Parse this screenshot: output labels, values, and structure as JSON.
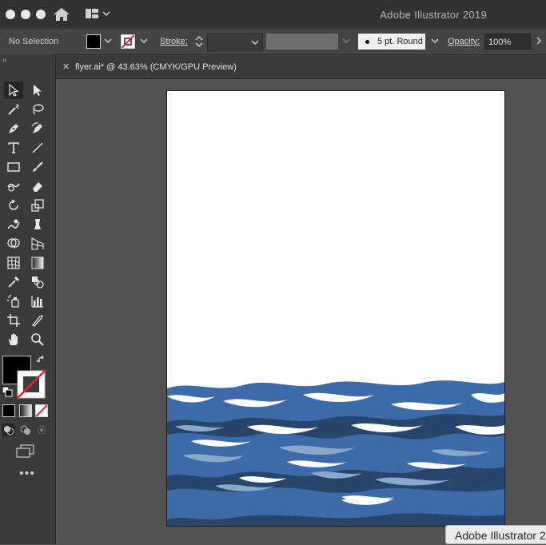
{
  "app": {
    "title": "Adobe Illustrator 2019"
  },
  "control_bar": {
    "selection_status": "No Selection",
    "fill_color": "#000000",
    "stroke_label": "Stroke:",
    "brush_label": "5 pt. Round",
    "opacity_label": "Opacity:",
    "opacity_value": "100%"
  },
  "tabs": [
    {
      "label": "flyer.ai* @ 43.63% (CMYK/GPU Preview)"
    }
  ],
  "tools": [
    "selection-tool",
    "direct-selection-tool",
    "magic-wand-tool",
    "lasso-tool",
    "pen-tool",
    "curvature-tool",
    "type-tool",
    "line-segment-tool",
    "rectangle-tool",
    "paintbrush-tool",
    "shaper-tool",
    "eraser-tool",
    "rotate-tool",
    "scale-tool",
    "warp-tool",
    "free-transform-tool",
    "shape-builder-tool",
    "perspective-grid-tool",
    "mesh-tool",
    "gradient-tool",
    "eyedropper-tool",
    "blend-tool",
    "symbol-sprayer-tool",
    "column-graph-tool",
    "artboard-tool",
    "slice-tool",
    "hand-tool",
    "zoom-tool"
  ],
  "colors": {
    "ocean_dark": "#28466c",
    "ocean_mid": "#3d6aa8",
    "ocean_light": "#8aa8cc",
    "ui_dark": "#323232"
  },
  "tooltip": {
    "text": "Adobe Illustrator 2"
  }
}
